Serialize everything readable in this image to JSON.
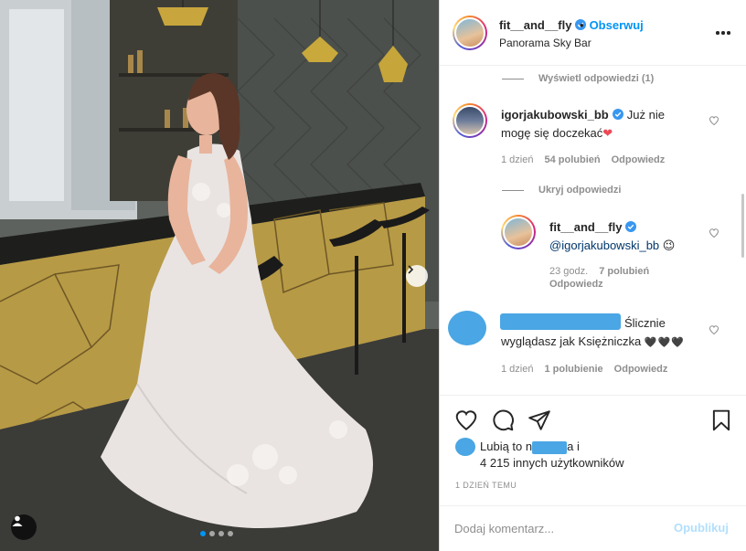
{
  "post": {
    "author": "fit__and__fly",
    "follow_label": "Obserwuj",
    "location": "Panorama Sky Bar",
    "carousel_dots": 4,
    "active_dot": 0
  },
  "comments": {
    "view_replies_label": "Wyświetl odpowiedzi (1)",
    "items": [
      {
        "username": "igorjakubowski_bb",
        "text_line1": "Już nie",
        "text_line2": "mogę się doczekać",
        "emoji": "❤",
        "time": "1 dzień",
        "likes": "54 polubień",
        "reply": "Odpowiedz"
      }
    ],
    "hide_replies_label": "Ukryj odpowiedzi",
    "reply": {
      "username": "fit__and__fly",
      "mention": "@igorjakubowski_bb",
      "emoji": "😉",
      "time": "23 godz.",
      "likes": "7 polubień",
      "reply": "Odpowiedz"
    },
    "third": {
      "text_line1": "Ślicznie",
      "text_line2": "wyglądasz jak Księżniczka",
      "emoji": "🖤🖤🖤",
      "time": "1 dzień",
      "likes": "1 polubienie",
      "reply": "Odpowiedz"
    }
  },
  "actions": {
    "likes_prefix": "Lubią to",
    "likes_mid_visible": "n",
    "likes_mid_suffix": "a i",
    "likes_count_text": "4 215 innych użytkowników",
    "time_ago": "1 DZIEŃ TEMU"
  },
  "add_comment": {
    "placeholder": "Dodaj komentarz...",
    "post_label": "Opublikuj"
  },
  "colors": {
    "accent": "#0095f6",
    "verified": "#3897f0",
    "redacted": "#4aa6e4",
    "heart": "#ed4956"
  }
}
